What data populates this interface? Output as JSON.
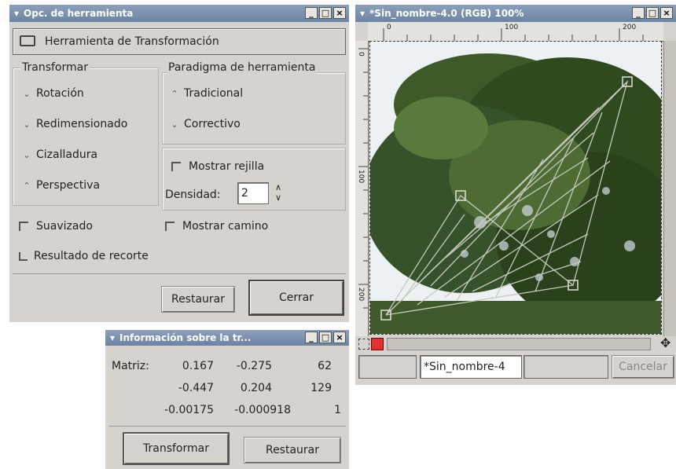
{
  "tool_options": {
    "title": "Opc. de herramienta",
    "header": "Herramienta de Transformación",
    "transform_group": {
      "legend": "Transformar",
      "options": [
        "Rotación",
        "Redimensionado",
        "Cizalladura",
        "Perspectiva"
      ],
      "selected": "Perspectiva"
    },
    "paradigm_group": {
      "legend": "Paradigma de herramienta",
      "options": [
        "Tradicional",
        "Correctivo"
      ],
      "selected": "Tradicional"
    },
    "show_grid_label": "Mostrar rejilla",
    "density_label": "Densidad:",
    "density_value": "2",
    "smoothing_label": "Suavizado",
    "show_path_label": "Mostrar camino",
    "clip_result_label": "Resultado de recorte",
    "reset_button": "Restaurar",
    "close_button": "Cerrar"
  },
  "image_window": {
    "title": "*Sin_nombre-4.0 (RGB) 100%",
    "ruler_top": [
      "0",
      "100",
      "200"
    ],
    "ruler_left": [
      "0",
      "100",
      "200"
    ],
    "status_name": "*Sin_nombre-4",
    "cancel_button": "Cancelar"
  },
  "transform_info": {
    "title": "Información sobre la tr...",
    "matrix_label": "Matriz:",
    "matrix": [
      [
        "0.167",
        "-0.275",
        "62"
      ],
      [
        "-0.447",
        "0.204",
        "129"
      ],
      [
        "-0.00175",
        "-0.000918",
        "1"
      ]
    ],
    "transform_button": "Transformar",
    "reset_button": "Restaurar"
  },
  "colors": {
    "titlebar": "#6c83a4",
    "window_bg": "#d6d3ce",
    "tree_dark": "#2f4a1f",
    "tree_mid": "#4d6b33",
    "grid_line": "#c8c8c0"
  },
  "icons": {
    "tool": "transform-tool-icon",
    "minimize": "minimize-icon",
    "maximize": "maximize-icon",
    "close": "close-icon",
    "navigate": "navigate-icon"
  }
}
